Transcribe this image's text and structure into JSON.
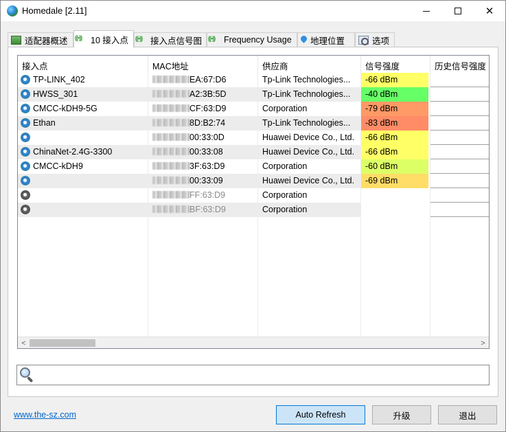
{
  "window": {
    "title": "Homedale [2.11]"
  },
  "tabs": [
    {
      "label": "适配器概述",
      "icon": "adapter-icon"
    },
    {
      "label": "10 接入点",
      "icon": "wifi-icon",
      "active": true
    },
    {
      "label": "接入点信号图",
      "icon": "wifi-icon"
    },
    {
      "label": "Frequency Usage",
      "icon": "wifi-icon"
    },
    {
      "label": "地理位置",
      "icon": "location-pin-icon"
    },
    {
      "label": "选项",
      "icon": "options-icon"
    }
  ],
  "table": {
    "columns": [
      "接入点",
      "MAC地址",
      "供应商",
      "信号强度",
      "历史信号强度"
    ],
    "rows": [
      {
        "ssid": "TP-LINK_402",
        "mac": "EA:67:D6",
        "vendor": "Tp-Link Technologies...",
        "signal": "-66 dBm",
        "signal_color": "#ffff66",
        "active": true
      },
      {
        "ssid": "HWSS_301",
        "mac": "A2:3B:5D",
        "vendor": "Tp-Link Technologies...",
        "signal": "-40 dBm",
        "signal_color": "#66ff66",
        "active": true
      },
      {
        "ssid": "CMCC-kDH9-5G",
        "mac": "CF:63:D9",
        "vendor": "Corporation",
        "signal": "-79 dBm",
        "signal_color": "#ff9966",
        "active": true
      },
      {
        "ssid": "Ethan",
        "mac": "8D:B2:74",
        "vendor": "Tp-Link Technologies...",
        "signal": "-83 dBm",
        "signal_color": "#ff8c66",
        "active": true
      },
      {
        "ssid": "",
        "mac": "00:33:0D",
        "vendor": "Huawei Device Co., Ltd.",
        "signal": "-66 dBm",
        "signal_color": "#ffff66",
        "active": true
      },
      {
        "ssid": "ChinaNet-2.4G-3300",
        "mac": "00:33:08",
        "vendor": "Huawei Device Co., Ltd.",
        "signal": "-66 dBm",
        "signal_color": "#ffff66",
        "active": true
      },
      {
        "ssid": "CMCC-kDH9",
        "mac": "3F:63:D9",
        "vendor": "Corporation",
        "signal": "-60 dBm",
        "signal_color": "#ddff66",
        "active": true
      },
      {
        "ssid": "",
        "mac": "00:33:09",
        "vendor": "Huawei Device Co., Ltd.",
        "signal": "-69 dBm",
        "signal_color": "#ffdd66",
        "active": true
      },
      {
        "ssid": "",
        "mac": "FF:63:D9",
        "vendor": "Corporation",
        "signal": "",
        "signal_color": "",
        "active": false
      },
      {
        "ssid": "",
        "mac": "BF:63:D9",
        "vendor": "Corporation",
        "signal": "",
        "signal_color": "",
        "active": false
      }
    ]
  },
  "search": {
    "value": "",
    "placeholder": ""
  },
  "footer": {
    "link": "www.the-sz.com",
    "buttons": {
      "auto_refresh": "Auto Refresh",
      "upgrade": "升级",
      "exit": "退出"
    }
  }
}
